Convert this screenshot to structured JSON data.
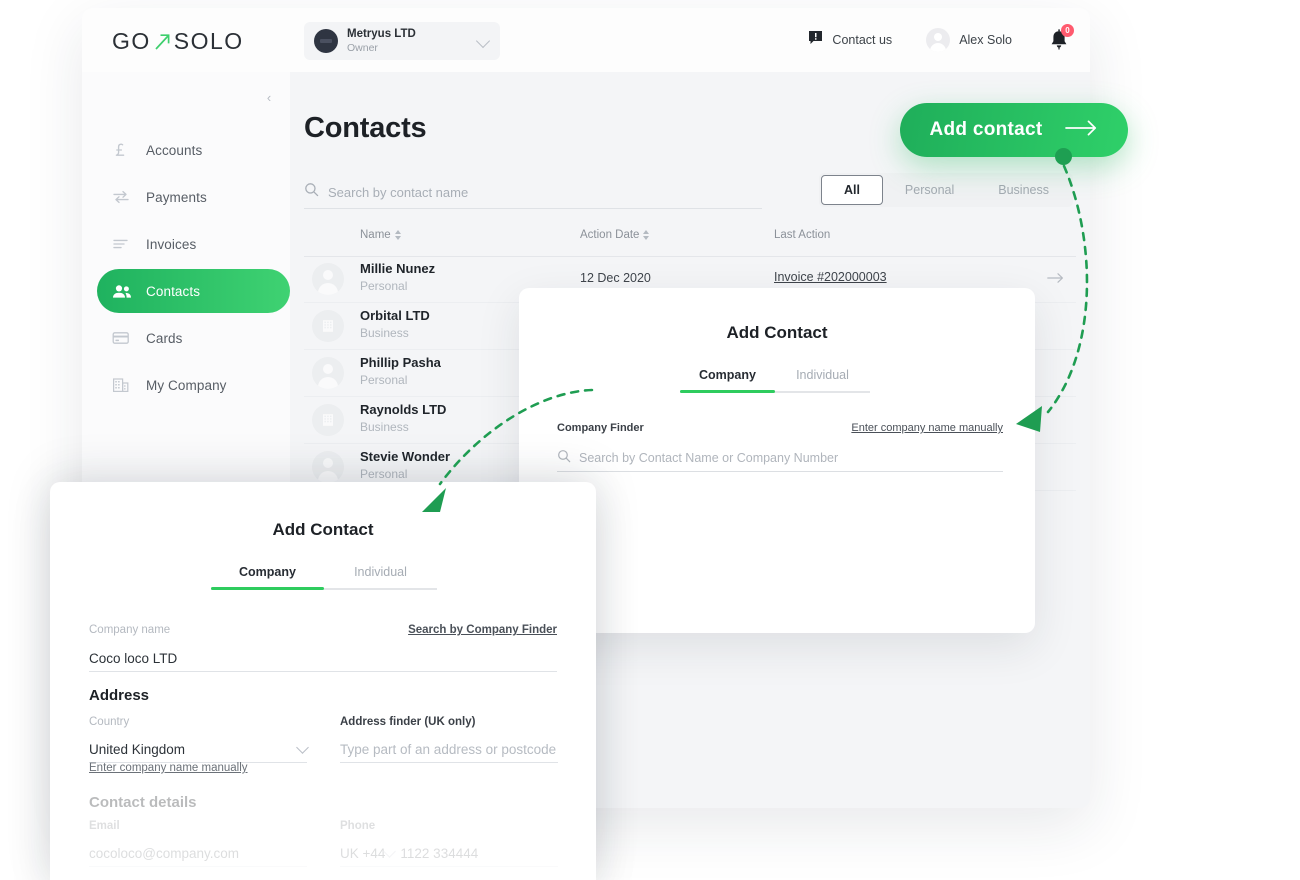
{
  "brand": {
    "logo_left": "GO",
    "logo_right": "SOLO",
    "accent_green": "#2ecc5e",
    "accent_green_dark": "#1fae5a",
    "badge_red": "#ff5a6e"
  },
  "topbar": {
    "org": {
      "name": "Metryus LTD",
      "role": "Owner",
      "chevron_icon": "chevron-down-icon"
    },
    "contact_us": {
      "label": "Contact us",
      "icon": "feedback-icon"
    },
    "user": {
      "name": "Alex Solo",
      "avatar_icon": "avatar-icon"
    },
    "notifications": {
      "icon": "bell-icon",
      "badge_count": "0"
    }
  },
  "sidebar": {
    "collapse_icon": "chevron-left-icon",
    "items": [
      {
        "label": "Accounts",
        "icon": "pound-icon",
        "active": false
      },
      {
        "label": "Payments",
        "icon": "transfer-icon",
        "active": false
      },
      {
        "label": "Invoices",
        "icon": "lines-icon",
        "active": false
      },
      {
        "label": "Contacts",
        "icon": "people-icon",
        "active": true
      },
      {
        "label": "Cards",
        "icon": "card-icon",
        "active": false
      },
      {
        "label": "My Company",
        "icon": "building-icon",
        "active": false
      }
    ]
  },
  "main": {
    "title": "Contacts",
    "search": {
      "placeholder": "Search by contact name",
      "value": "",
      "icon": "search-icon"
    },
    "filters": [
      {
        "label": "All",
        "active": true
      },
      {
        "label": "Personal",
        "active": false
      },
      {
        "label": "Business",
        "active": false
      }
    ],
    "table": {
      "columns": [
        {
          "label": "Name",
          "sortable": true
        },
        {
          "label": "Action Date",
          "sortable": true
        },
        {
          "label": "Last Action",
          "sortable": false
        }
      ],
      "rows": [
        {
          "name": "Millie Nunez",
          "type": "Personal",
          "avatar": "person",
          "date": "12 Dec 2020",
          "last_action": "Invoice #202000003",
          "go_icon": "arrow-right-icon"
        },
        {
          "name": "Orbital LTD",
          "type": "Business",
          "avatar": "building",
          "date": "",
          "last_action": "",
          "go_icon": "arrow-right-icon"
        },
        {
          "name": "Phillip Pasha",
          "type": "Personal",
          "avatar": "person",
          "date": "",
          "last_action": "",
          "go_icon": "arrow-right-icon"
        },
        {
          "name": "Raynolds LTD",
          "type": "Business",
          "avatar": "building",
          "date": "",
          "last_action": "",
          "go_icon": "arrow-right-icon"
        },
        {
          "name": "Stevie Wonder",
          "type": "Personal",
          "avatar": "person",
          "date": "",
          "last_action": "",
          "go_icon": "arrow-right-icon"
        }
      ]
    }
  },
  "cta": {
    "label": "Add contact",
    "icon": "arrow-right-icon"
  },
  "modal_company_finder": {
    "title": "Add Contact",
    "tabs": [
      {
        "label": "Company",
        "active": true
      },
      {
        "label": "Individual",
        "active": false
      }
    ],
    "field_label": "Company Finder",
    "field_link": "Enter company name manually",
    "search_placeholder": "Search by Contact Name or Company Number",
    "search_icon": "search-icon"
  },
  "modal_company_manual": {
    "title": "Add Contact",
    "tabs": [
      {
        "label": "Company",
        "active": true
      },
      {
        "label": "Individual",
        "active": false
      }
    ],
    "company_name_label": "Company name",
    "company_name_link": "Search by Company Finder",
    "company_name_value": "Coco loco LTD",
    "address_heading": "Address",
    "country_label": "Country",
    "country_value": "United Kingdom",
    "country_chevron_icon": "chevron-down-icon",
    "address_finder_label": "Address finder (UK only)",
    "address_finder_placeholder": "Type part of an address or postcode",
    "manual_link": "Enter company name manually",
    "contact_details_heading": "Contact details",
    "email_label": "Email",
    "email_value": "cocoloco@company.com",
    "phone_label": "Phone",
    "phone_prefix": "UK +44",
    "phone_chevron_icon": "chevron-down-icon",
    "phone_value": "1122  334444"
  }
}
